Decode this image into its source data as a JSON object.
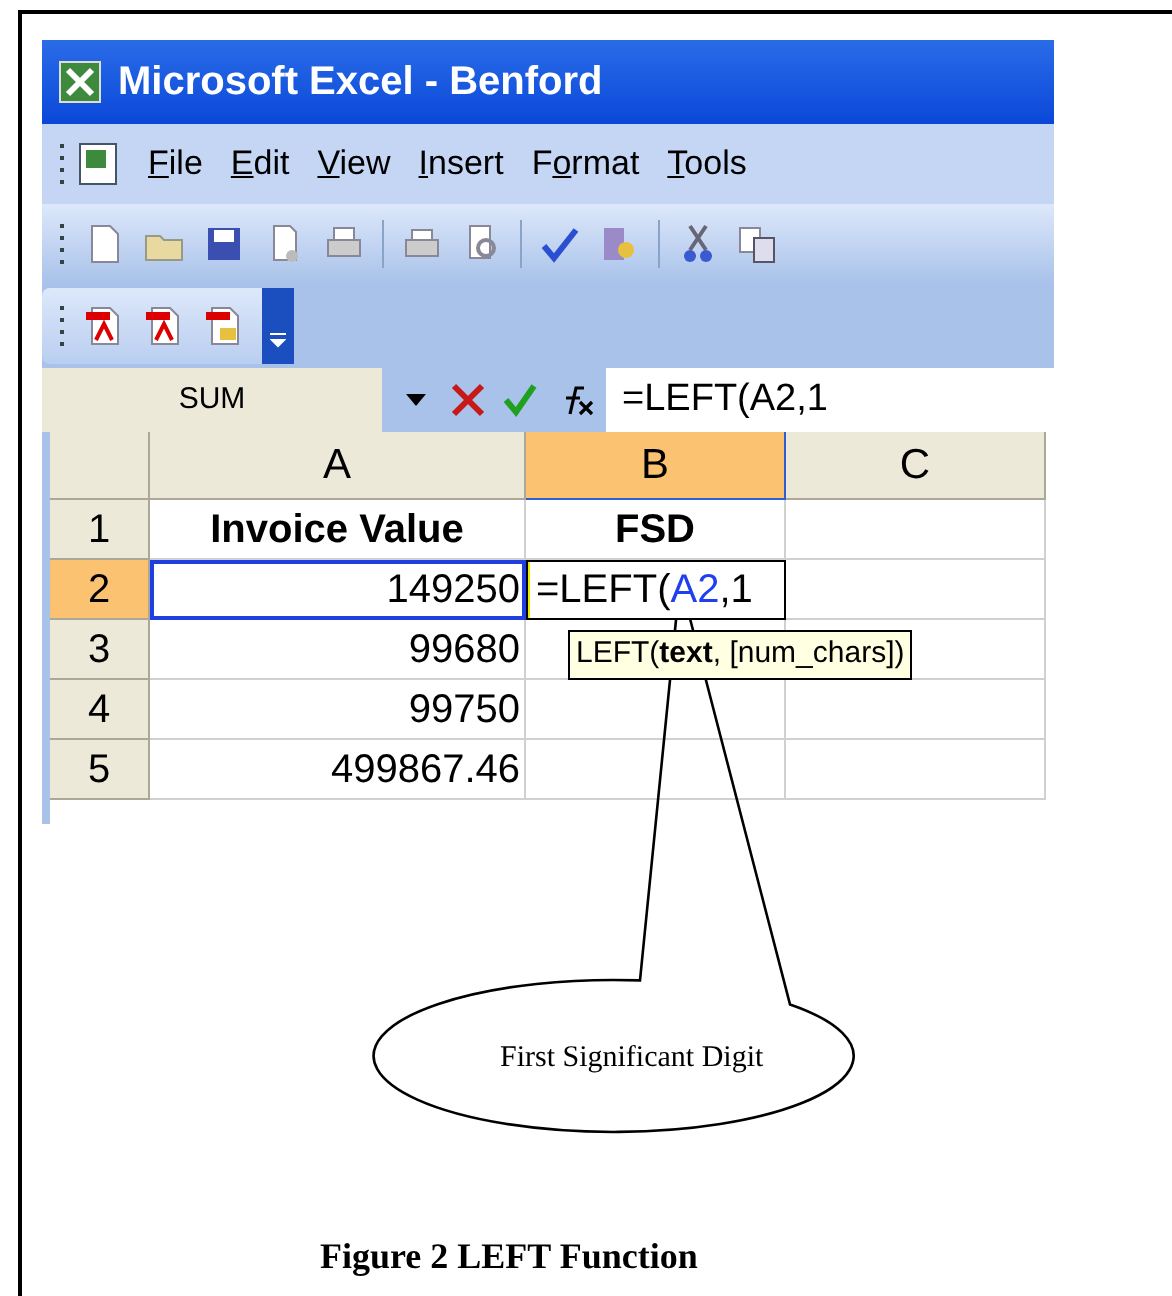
{
  "window": {
    "title": "Microsoft Excel - Benford"
  },
  "menu": [
    {
      "access_key": "F",
      "after": "ile"
    },
    {
      "access_key": "E",
      "after": "dit"
    },
    {
      "access_key": "V",
      "after": "iew"
    },
    {
      "access_key": "I",
      "after": "nsert"
    },
    {
      "before": "F",
      "access_key": "o",
      "after": "rmat"
    },
    {
      "access_key": "T",
      "after": "ools"
    }
  ],
  "formula_bar": {
    "name_box": "SUM",
    "formula": "=LEFT(A2,1"
  },
  "columns": [
    {
      "label": "A",
      "selected": false
    },
    {
      "label": "B",
      "selected": true
    },
    {
      "label": "C",
      "selected": false
    }
  ],
  "rows": [
    {
      "label": "1",
      "selected": false,
      "cells": [
        {
          "kind": "header",
          "text": "Invoice Value"
        },
        {
          "kind": "header",
          "text": "FSD"
        },
        {
          "kind": "empty"
        }
      ]
    },
    {
      "label": "2",
      "selected": true,
      "cells": [
        {
          "kind": "number",
          "text": "149250",
          "referenced": true
        },
        {
          "kind": "editing",
          "before": "=LEFT(",
          "ref": "A2",
          "after": ",1"
        },
        {
          "kind": "empty"
        }
      ]
    },
    {
      "label": "3",
      "selected": false,
      "cells": [
        {
          "kind": "number",
          "text": "99680",
          "referenced": false
        },
        {
          "kind": "empty"
        },
        {
          "kind": "empty"
        }
      ]
    },
    {
      "label": "4",
      "selected": false,
      "cells": [
        {
          "kind": "number",
          "text": "99750",
          "referenced": false
        },
        {
          "kind": "empty"
        },
        {
          "kind": "empty"
        }
      ]
    },
    {
      "label": "5",
      "selected": false,
      "cells": [
        {
          "kind": "number",
          "text": "499867.46",
          "referenced": false
        },
        {
          "kind": "empty"
        },
        {
          "kind": "empty"
        }
      ]
    }
  ],
  "tooltip": "LEFT(**text**, [num_chars])",
  "callout": "First Significant Digit",
  "caption": "Figure 2 LEFT Function"
}
